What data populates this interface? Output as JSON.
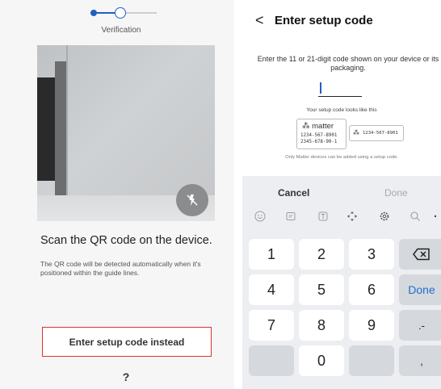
{
  "left": {
    "stepper_label": "Verification",
    "scan_title": "Scan the QR code on the device.",
    "scan_description": "The QR code will be detected automatically when it's positioned within the guide lines.",
    "enter_code_button": "Enter setup code instead",
    "help_label": "?",
    "icons": {
      "flash": "flash-off-icon"
    }
  },
  "right": {
    "back_glyph": "<",
    "title": "Enter setup code",
    "instructions": "Enter the 11 or 21-digit code shown on your device or its packaging.",
    "hint": "Your setup code looks like this",
    "example_card_1": {
      "brand": "matter",
      "code_line_1": "1234-567-8901",
      "code_line_2": "2345-678-90-1"
    },
    "example_card_2": {
      "code": "1234-567-8901"
    },
    "note": "Only Matter devices can be added using a setup code.",
    "keyboard": {
      "cancel": "Cancel",
      "done_top": "Done",
      "keys": {
        "k1": "1",
        "k2": "2",
        "k3": "3",
        "k4": "4",
        "k5": "5",
        "k6": "6",
        "k7": "7",
        "k8": "8",
        "k9": "9",
        "k0": "0",
        "done": "Done",
        "dot_dash": ".-",
        "comma": ","
      }
    }
  },
  "colors": {
    "accent_blue": "#1f5fbf",
    "highlight_red": "#e03030",
    "keyboard_bg": "#eceef1"
  }
}
